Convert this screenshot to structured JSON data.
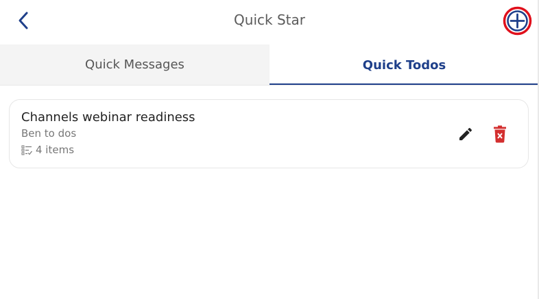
{
  "header": {
    "title": "Quick Star",
    "back_icon": "chevron-left-icon",
    "add_icon": "plus-circle-icon"
  },
  "tabs": [
    {
      "label": "Quick Messages",
      "active": false
    },
    {
      "label": "Quick Todos",
      "active": true
    }
  ],
  "todos": [
    {
      "title": "Channels webinar readiness",
      "subtitle": "Ben to dos",
      "count_label": "4 items",
      "edit_icon": "pencil-icon",
      "delete_icon": "trash-icon"
    }
  ],
  "colors": {
    "accent": "#1e3f8a",
    "highlight_ring": "#e0101c",
    "delete": "#d32f2f"
  }
}
